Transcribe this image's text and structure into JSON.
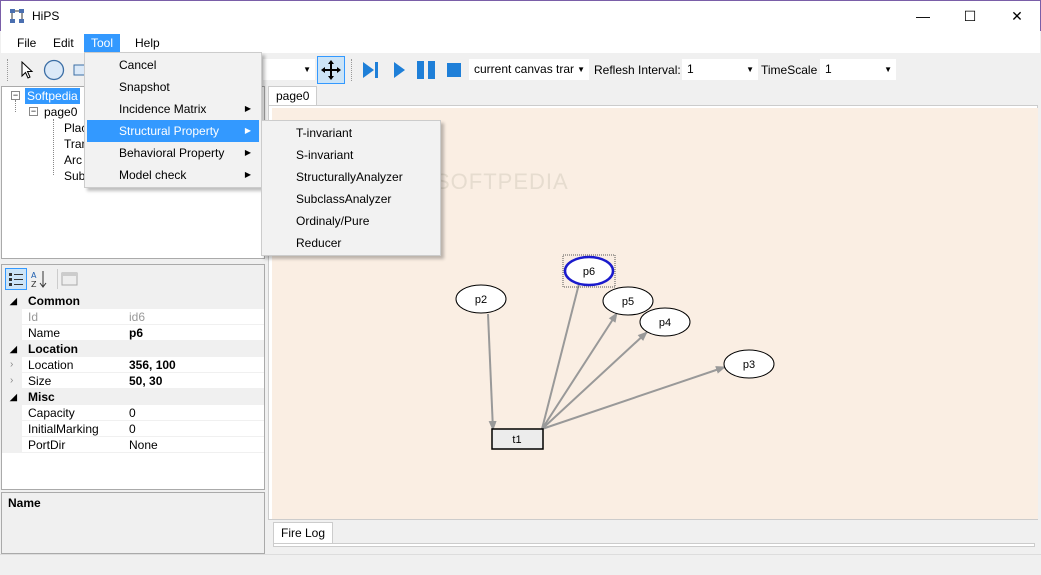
{
  "window": {
    "title": "HiPS",
    "minimize": "—",
    "maximize": "☐",
    "close": "✕"
  },
  "menubar": {
    "file": "File",
    "edit": "Edit",
    "tool": "Tool",
    "help": "Help"
  },
  "toolbar": {
    "view_combo": "current canvas trar",
    "interval_label": "Reflesh Interval:",
    "interval_value": "1",
    "timescale_label": "TimeScale",
    "timescale_value": "1"
  },
  "tree": {
    "root": "Softpedia",
    "page": "page0",
    "children": [
      "Plac",
      "Tran",
      "Arc",
      "Sub"
    ]
  },
  "props": {
    "cat_common": "Common",
    "id_label": "Id",
    "id_value": "id6",
    "name_label": "Name",
    "name_value": "p6",
    "cat_location": "Location",
    "loc_label": "Location",
    "loc_value": "356, 100",
    "size_label": "Size",
    "size_value": "50, 30",
    "cat_misc": "Misc",
    "cap_label": "Capacity",
    "cap_value": "0",
    "im_label": "InitialMarking",
    "im_value": "0",
    "pd_label": "PortDir",
    "pd_value": "None",
    "desc_title": "Name"
  },
  "tabs": {
    "doc": "page0",
    "firelog": "Fire Log"
  },
  "watermark": "SOFTPEDIA",
  "canvas": {
    "places": {
      "p6": "p6",
      "p5": "p5",
      "p4": "p4",
      "p3": "p3",
      "p2": "p2"
    },
    "transition": "t1"
  },
  "tool_menu": {
    "cancel": "Cancel",
    "snapshot": "Snapshot",
    "incidence": "Incidence Matrix",
    "structural": "Structural Property",
    "behavioral": "Behavioral Property",
    "modelcheck": "Model check"
  },
  "structural_menu": {
    "t_inv": "T-invariant",
    "s_inv": "S-invariant",
    "struct_an": "StructurallyAnalyzer",
    "subclass_an": "SubclassAnalyzer",
    "ordinaly": "Ordinaly/Pure",
    "reducer": "Reducer"
  },
  "colors": {
    "accent": "#3399ff",
    "canvas": "#faeee3",
    "selected": "#1a1acc",
    "toolbar_icon": "#1e7fd8"
  }
}
